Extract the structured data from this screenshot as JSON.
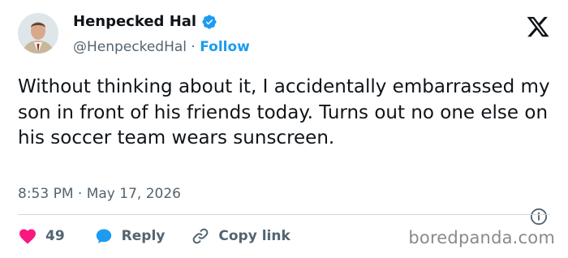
{
  "author": {
    "name": "Henpecked Hal",
    "handle": "@HenpeckedHal",
    "separator": " · ",
    "follow_label": "Follow",
    "verified_icon": "verified-badge-icon",
    "avatar_icon": "avatar"
  },
  "tweet": {
    "text": "Without thinking about it, I accidentally embarrassed my son in front of his friends today. Turns out no one else on his soccer team wears sunscreen.",
    "timestamp": "8:53 PM · May 17, 2026"
  },
  "actions": {
    "like_count": "49",
    "reply_label": "Reply",
    "copy_link_label": "Copy link"
  },
  "branding": {
    "platform_icon": "x-logo-icon",
    "watermark": "boredpanda.com"
  },
  "colors": {
    "accent": "#1d9bf0",
    "like": "#f91880",
    "secondary_text": "#536471",
    "primary_text": "#0f1419"
  }
}
